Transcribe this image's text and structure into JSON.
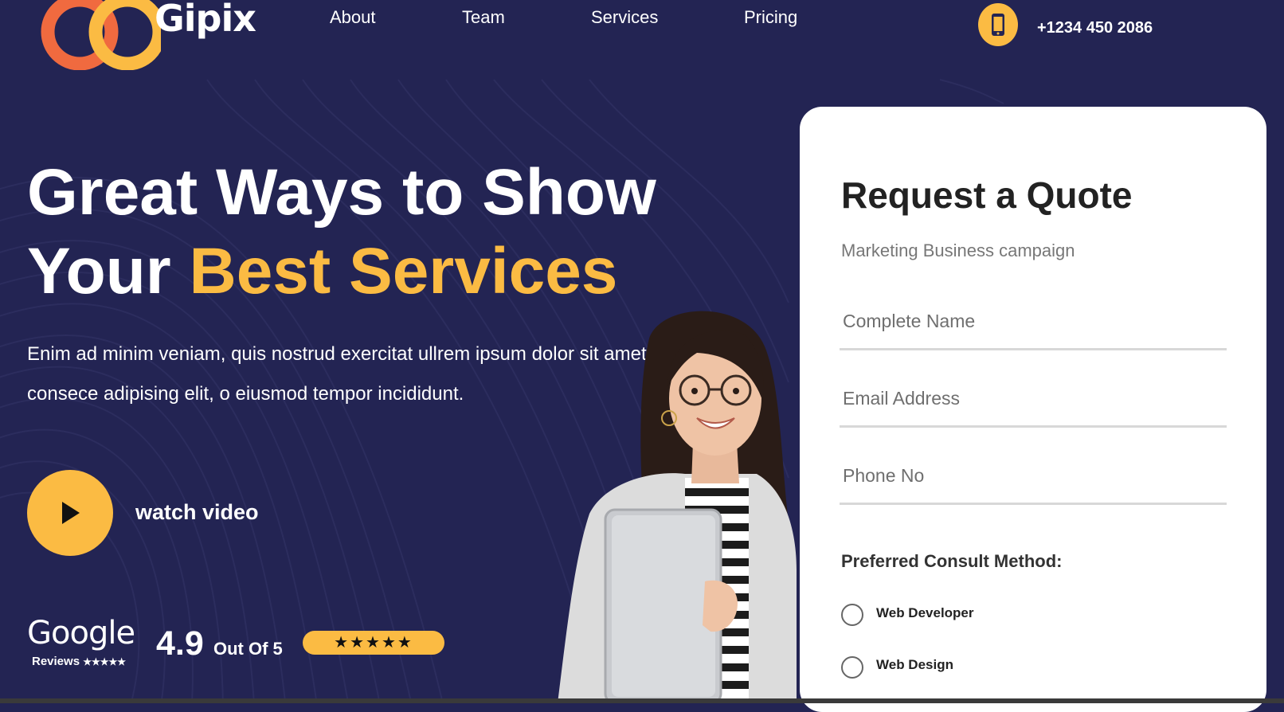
{
  "brand": {
    "name": "Gipix",
    "logo_icon": "interlocking-rings-logo",
    "colors": {
      "background": "#232453",
      "accent": "#fbbb43",
      "logo_orange": "#f06a3f",
      "logo_yellow": "#fbbb43"
    }
  },
  "nav": {
    "items": [
      {
        "label": "About"
      },
      {
        "label": "Team"
      },
      {
        "label": "Services"
      },
      {
        "label": "Pricing"
      }
    ],
    "phone_icon": "smartphone-icon",
    "phone": "+1234 450 2086"
  },
  "hero": {
    "title_line1": "Great Ways to Show",
    "title_line2_prefix": "Your ",
    "title_line2_accent": "Best Services",
    "description": "Enim ad minim veniam, quis nostrud exercitat ullrem ipsum dolor sit amet, consece adipising elit, o eiusmod tempor incididunt.",
    "video_icon": "play-icon",
    "video_label": "watch video"
  },
  "rating": {
    "provider": "Google",
    "provider_sub": "Reviews",
    "sub_stars": "★★★★★",
    "score": "4.9",
    "out_of": "Out Of 5",
    "stars": "★★★★★",
    "star_count": 5
  },
  "quote_form": {
    "title": "Request a Quote",
    "subtitle": "Marketing Business campaign",
    "fields": {
      "name_placeholder": "Complete Name",
      "email_placeholder": "Email Address",
      "phone_placeholder": "Phone No"
    },
    "consult_label": "Preferred Consult Method:",
    "options": [
      {
        "label": "Web Developer"
      },
      {
        "label": "Web Design"
      }
    ]
  }
}
